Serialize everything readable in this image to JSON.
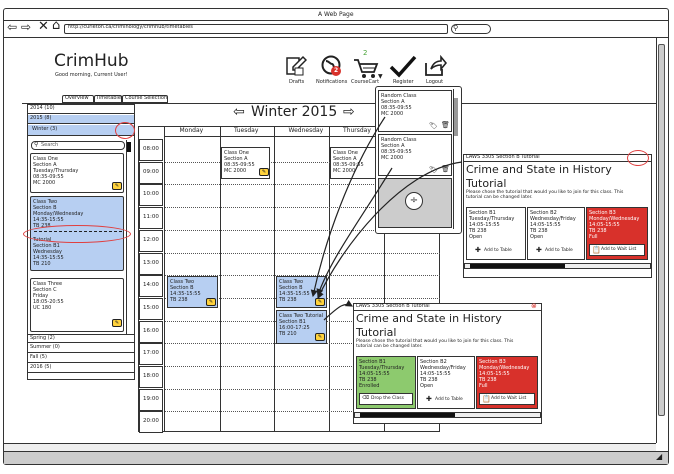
{
  "browser": {
    "title": "A Web Page",
    "url": "http://curieton.ca/criminology/crimhub/timetables"
  },
  "app": {
    "name": "CrimHub",
    "greeting": "Good morning, Current User!"
  },
  "toolbar": {
    "drafts": "Drafts",
    "notifications": "Notifications",
    "notif_count": "2",
    "cart": "CourseCart",
    "cart_count": "2",
    "register": "Register",
    "logout": "Logout"
  },
  "tabs": [
    "Overview",
    "Timetables",
    "Course Selection"
  ],
  "semesters": [
    "2014 (10)",
    "2015 (8)",
    "Winter (3)",
    "Spring (2)",
    "Summer (0)",
    "Fall (5)",
    "2016 (5)"
  ],
  "search": {
    "placeholder": "Search"
  },
  "left_courses": [
    "Class One\nSection A\nTuesday/Thursday\n08:35-09:55\nMC 2000",
    "Class Two\nSection B\nMonday/Wednesday\n14:35-15:55\nTB 238",
    "Tutorial\nSection B1\nWednesday\n14:35-15:55\nTB 210",
    "Class Three\nSection C\nFriday\n18:05-20:55\nUC 180"
  ],
  "calendar": {
    "title": "Winter 2015",
    "days": [
      "Monday",
      "Tuesday",
      "Wednesday",
      "Thursday"
    ],
    "times": [
      "08:00",
      "09:00",
      "10:00",
      "11:00",
      "12:00",
      "13:00",
      "14:00",
      "15:00",
      "16:00",
      "17:00",
      "18:00",
      "19:00",
      "20:00"
    ]
  },
  "events": [
    "Class One\nSection A\n08:35-09:55\nMC 2000",
    "Class One\nSection A\n08:35-09:55\nMC 2000",
    "Class Two\nSection B\n14:35-15:55\nTB 238",
    "Class Two\nSection B\n14:35-15:55\nTB 238",
    "Class Two Tutorial\nSection B1\n16:00-17:25\nTB 210"
  ],
  "cart_items": [
    "Random Class\nSection A\n08:35-09:55\nMC 2000",
    "Random Class\nSection A\n08:35-09:55\nMC 2000"
  ],
  "popup1": {
    "header": "LAWS 3305 Section B Tutorial",
    "title": "Crime and State in History\nTutorial",
    "desc": "Please chose the tutorial that would you like to join for this class. This\ntutorial can be changed later.",
    "options": [
      "Section B1\nTuesday/Thursday\n14:05-15:55\nTB 238\nOpen",
      "Section B2\nWednesday/Friday\n14:05-15:55\nTB 238\nOpen",
      "Section B3\nMonday/Wednesday\n14:05-15:55\nTB 238\nFull"
    ],
    "actions": [
      "Add to Table",
      "Add to Table",
      "Add to Wait List"
    ]
  },
  "popup2": {
    "header": "LAWS 3305 Section B Tutorial",
    "title": "Crime and State in History\nTutorial",
    "desc": "Please chose the tutorial that would you like to join for this class. This\ntutorial can be changed later.",
    "options": [
      "Section B1\nTuesday/Thursday\n14:05-15:55\nTB 238\nEnrolled",
      "Section B2\nWednesday/Friday\n14:05-15:55\nTB 238\nOpen",
      "Section B3\nMonday/Wednesday\n14:05-15:55\nTB 238\nFull"
    ],
    "actions": [
      "Drop the Class",
      "Add to Table",
      "Add to Wait List"
    ]
  },
  "colors": {
    "blue": "#b7cff2",
    "red": "#d8312b",
    "green": "#8dca6e",
    "yellow": "#ffd23c",
    "highlight_circle": "#e04040"
  }
}
